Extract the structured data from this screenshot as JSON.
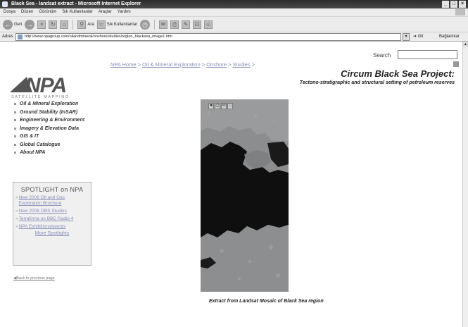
{
  "window": {
    "title": "Black Sea - landsat extract - Microsoft Internet Explorer",
    "controls": [
      "_",
      "□",
      "×"
    ]
  },
  "menu": [
    "Dosya",
    "Düzen",
    "Görünüm",
    "Sık Kullanılanlar",
    "Araçlar",
    "Yardım"
  ],
  "toolbar": {
    "back_label": "Geri",
    "search_label": "Ara",
    "favorites_label": "Sık Kullanılanlar"
  },
  "address": {
    "label": "Adres",
    "url": "http://www.npagroup.com/oilandmineral/onshore/studies/region_blacksea_image1.htm",
    "go_label": "Git",
    "links_label": "Bağlantılar"
  },
  "page": {
    "search_label": "Search",
    "logo": {
      "wordmark": "NPA",
      "tagline": "SATELLITE MAPPING"
    },
    "breadcrumb": [
      {
        "label": "NPA Home"
      },
      {
        "label": "Oil & Mineral Exploration"
      },
      {
        "label": "Onshore"
      },
      {
        "label": "Studies"
      }
    ],
    "breadcrumb_sep": " > ",
    "project_title": "Circum Black Sea Project:",
    "project_subtitle": "Tectono-stratigraphic and structural setting of petroleum reserves",
    "nav": [
      "Oil & Mineral Exploration",
      "Ground Stability (InSAR)",
      "Engineering & Environment",
      "Imagery & Elevation Data",
      "GIS & IT",
      "Global Catalogue",
      "About NPA"
    ],
    "spotlight": {
      "title": "SPOTLIGHT on NPA",
      "items": [
        "New 2006 Oil and Gas Exploration Brochure",
        "New 2006 OBS Studies",
        "Terrafirma on BBC Radio 4",
        "NPA Exhibitions/events"
      ],
      "more": "More Spotlights"
    },
    "back_link": "Back to previous page",
    "caption": "Extract from Landsat Mosaic of Black Sea region"
  }
}
